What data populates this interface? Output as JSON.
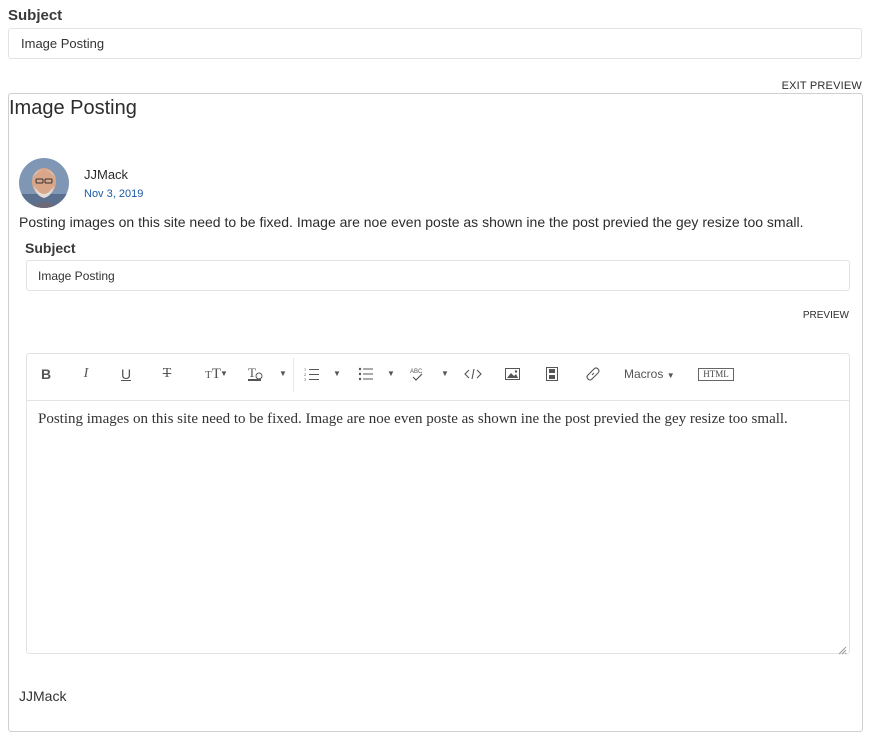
{
  "subject": {
    "label": "Subject",
    "value": "Image Posting"
  },
  "exit_preview_label": "EXIT PREVIEW",
  "post": {
    "title": "Image Posting",
    "author": "JJMack",
    "date": "Nov 3, 2019",
    "body": "Posting images on this site need to be fixed. Image are noe even poste as shown ine the post previed the gey resize too small.",
    "signature": "JJMack"
  },
  "reply": {
    "subject_label": "Subject",
    "subject_value": "Image Posting",
    "preview_label": "PREVIEW",
    "editor_text": "Posting images on this site need to be fixed. Image are noe even poste as shown ine the post previed the gey resize too small."
  },
  "toolbar": {
    "bold": "B",
    "italic": "I",
    "underline": "U",
    "strike": "T",
    "font_size": "TT",
    "macros_label": "Macros",
    "html_label": "HTML",
    "icons": [
      "bold-icon",
      "italic-icon",
      "underline-icon",
      "strikethrough-icon",
      "font-size-icon",
      "text-color-icon",
      "numbered-list-icon",
      "bullet-list-icon",
      "spellcheck-icon",
      "code-icon",
      "insert-image-icon",
      "insert-video-icon",
      "insert-link-icon",
      "html-icon"
    ]
  },
  "colors": {
    "date_link": "#1a5aa6",
    "border": "#cfcfcf"
  }
}
